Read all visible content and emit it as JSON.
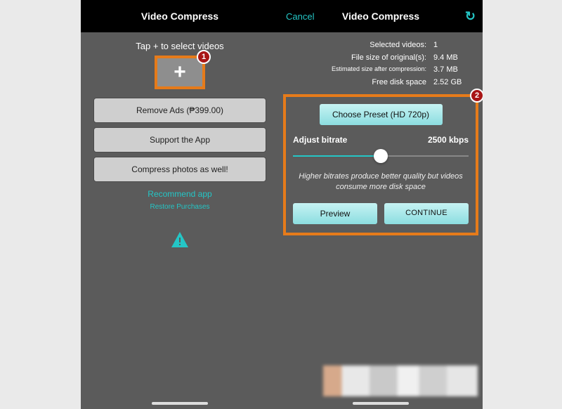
{
  "left": {
    "title": "Video Compress",
    "tap_hint": "Tap + to select videos",
    "add_icon": "+",
    "buttons": {
      "remove_ads": "Remove Ads (₱399.00)",
      "support": "Support the App",
      "compress_photos": "Compress photos as well!"
    },
    "recommend": "Recommend app",
    "restore": "Restore Purchases",
    "badge": "1"
  },
  "right": {
    "cancel": "Cancel",
    "title": "Video Compress",
    "refresh_icon": "↻",
    "info": {
      "selected_label": "Selected videos:",
      "selected_value": "1",
      "original_label": "File size of original(s):",
      "original_value": "9.4 MB",
      "estimated_label": "Estimated size after compression:",
      "estimated_value": "3.7 MB",
      "freespace_label": "Free disk space",
      "freespace_value": "2.52 GB"
    },
    "preset": "Choose Preset (HD 720p)",
    "adjust_label": "Adjust bitrate",
    "bitrate_value": "2500 kbps",
    "hint": "Higher bitrates produce better quality but videos consume more disk space",
    "preview": "Preview",
    "continue": "CONTINUE",
    "badge": "2"
  }
}
